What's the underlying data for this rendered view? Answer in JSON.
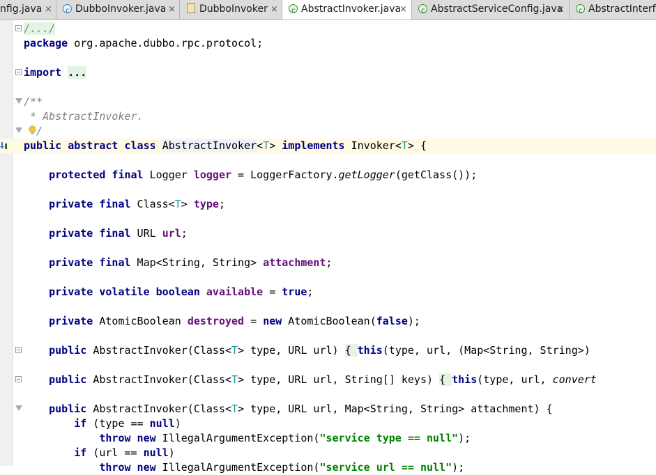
{
  "tabs": [
    {
      "label": "nfig.java",
      "icon": "class-icon",
      "closable": true,
      "active": false
    },
    {
      "label": "DubboInvoker.java",
      "icon": "class-icon",
      "closable": true,
      "active": false
    },
    {
      "label": "DubboInvoker",
      "icon": "file-icon",
      "closable": true,
      "active": false
    },
    {
      "label": "AbstractInvoker.java",
      "icon": "abstract-class-icon",
      "closable": true,
      "active": true
    },
    {
      "label": "AbstractServiceConfig.java",
      "icon": "abstract-class-icon",
      "closable": true,
      "active": false
    },
    {
      "label": "AbstractInterfa",
      "icon": "abstract-class-icon",
      "closable": false,
      "active": false
    }
  ],
  "close_glyph": "×",
  "code_lines": [
    {
      "tokens": [
        {
          "t": "/.../",
          "c": "cmt hl"
        }
      ],
      "fold": "closed"
    },
    {
      "tokens": [
        {
          "t": "package",
          "c": "kw"
        },
        {
          "t": " org.apache.dubbo.rpc.protocol;"
        }
      ]
    },
    {
      "tokens": []
    },
    {
      "tokens": [
        {
          "t": "import",
          "c": "kw"
        },
        {
          "t": " "
        },
        {
          "t": "...",
          "c": "kw hl"
        }
      ],
      "fold": "closed"
    },
    {
      "tokens": []
    },
    {
      "tokens": [
        {
          "t": "/**",
          "c": "cmt"
        }
      ],
      "fold": "open"
    },
    {
      "tokens": [
        {
          "t": " * AbstractInvoker.",
          "c": "cmt"
        }
      ]
    },
    {
      "tokens": [
        {
          "t": "  /",
          "c": "cmt"
        }
      ],
      "bulb": true,
      "fold": "open"
    },
    {
      "tokens": [
        {
          "t": "public abstract class",
          "c": "kw"
        },
        {
          "t": " "
        },
        {
          "t": "AbstractInvoker",
          "c": "hl-blue"
        },
        {
          "t": "<",
          "c": ""
        },
        {
          "t": "T",
          "c": "tp"
        },
        {
          "t": "> "
        },
        {
          "t": "implements",
          "c": "kw"
        },
        {
          "t": " Invoker<"
        },
        {
          "t": "T",
          "c": "tp"
        },
        {
          "t": "> {"
        }
      ],
      "current": true,
      "run": true
    },
    {
      "tokens": []
    },
    {
      "tokens": [
        {
          "t": "    "
        },
        {
          "t": "protected final",
          "c": "kw"
        },
        {
          "t": " Logger "
        },
        {
          "t": "logger",
          "c": "fld"
        },
        {
          "t": " = LoggerFactory."
        },
        {
          "t": "getLogger",
          "c": "it"
        },
        {
          "t": "(getClass());"
        }
      ]
    },
    {
      "tokens": []
    },
    {
      "tokens": [
        {
          "t": "    "
        },
        {
          "t": "private final",
          "c": "kw"
        },
        {
          "t": " Class<"
        },
        {
          "t": "T",
          "c": "tp"
        },
        {
          "t": "> "
        },
        {
          "t": "type",
          "c": "fld"
        },
        {
          "t": ";"
        }
      ]
    },
    {
      "tokens": []
    },
    {
      "tokens": [
        {
          "t": "    "
        },
        {
          "t": "private final",
          "c": "kw"
        },
        {
          "t": " URL "
        },
        {
          "t": "url",
          "c": "fld"
        },
        {
          "t": ";"
        }
      ]
    },
    {
      "tokens": []
    },
    {
      "tokens": [
        {
          "t": "    "
        },
        {
          "t": "private final",
          "c": "kw"
        },
        {
          "t": " Map<String, String> "
        },
        {
          "t": "attachment",
          "c": "fld"
        },
        {
          "t": ";"
        }
      ]
    },
    {
      "tokens": []
    },
    {
      "tokens": [
        {
          "t": "    "
        },
        {
          "t": "private volatile boolean",
          "c": "kw"
        },
        {
          "t": " "
        },
        {
          "t": "available",
          "c": "fld"
        },
        {
          "t": " = "
        },
        {
          "t": "true",
          "c": "kw"
        },
        {
          "t": ";"
        }
      ]
    },
    {
      "tokens": []
    },
    {
      "tokens": [
        {
          "t": "    "
        },
        {
          "t": "private",
          "c": "kw"
        },
        {
          "t": " AtomicBoolean "
        },
        {
          "t": "destroyed",
          "c": "fld"
        },
        {
          "t": " = "
        },
        {
          "t": "new",
          "c": "kw"
        },
        {
          "t": " AtomicBoolean("
        },
        {
          "t": "false",
          "c": "kw"
        },
        {
          "t": ");"
        }
      ]
    },
    {
      "tokens": []
    },
    {
      "tokens": [
        {
          "t": "    "
        },
        {
          "t": "public",
          "c": "kw"
        },
        {
          "t": " AbstractInvoker(Class<"
        },
        {
          "t": "T",
          "c": "tp"
        },
        {
          "t": "> type, URL url) "
        },
        {
          "t": "{ ",
          "c": "hl"
        },
        {
          "t": "this",
          "c": "kw"
        },
        {
          "t": "(type, url, (Map<String, String>)"
        }
      ],
      "fold": "closed"
    },
    {
      "tokens": []
    },
    {
      "tokens": [
        {
          "t": "    "
        },
        {
          "t": "public",
          "c": "kw"
        },
        {
          "t": " AbstractInvoker(Class<"
        },
        {
          "t": "T",
          "c": "tp"
        },
        {
          "t": "> type, URL url, String[] keys) "
        },
        {
          "t": "{ ",
          "c": "hl"
        },
        {
          "t": "this",
          "c": "kw"
        },
        {
          "t": "(type, url, "
        },
        {
          "t": "convert",
          "c": "it"
        }
      ],
      "fold": "closed"
    },
    {
      "tokens": []
    },
    {
      "tokens": [
        {
          "t": "    "
        },
        {
          "t": "public",
          "c": "kw"
        },
        {
          "t": " AbstractInvoker(Class<"
        },
        {
          "t": "T",
          "c": "tp"
        },
        {
          "t": "> type, URL url, Map<String, String> attachment) {"
        }
      ],
      "fold": "open"
    },
    {
      "tokens": [
        {
          "t": "        "
        },
        {
          "t": "if",
          "c": "kw"
        },
        {
          "t": " (type == "
        },
        {
          "t": "null",
          "c": "kw"
        },
        {
          "t": ")"
        }
      ]
    },
    {
      "tokens": [
        {
          "t": "            "
        },
        {
          "t": "throw new",
          "c": "kw"
        },
        {
          "t": " IllegalArgumentException("
        },
        {
          "t": "\"service type == null\"",
          "c": "str"
        },
        {
          "t": ");"
        }
      ]
    },
    {
      "tokens": [
        {
          "t": "        "
        },
        {
          "t": "if",
          "c": "kw"
        },
        {
          "t": " (url == "
        },
        {
          "t": "null",
          "c": "kw"
        },
        {
          "t": ")"
        }
      ]
    },
    {
      "tokens": [
        {
          "t": "            "
        },
        {
          "t": "throw new",
          "c": "kw"
        },
        {
          "t": " IllegalArgumentException("
        },
        {
          "t": "\"service url == null\"",
          "c": "str"
        },
        {
          "t": ");"
        }
      ]
    }
  ]
}
